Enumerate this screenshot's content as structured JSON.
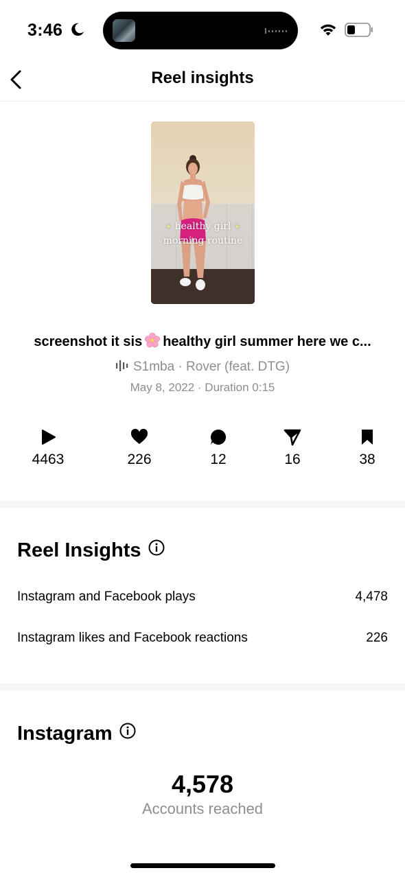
{
  "status_bar": {
    "time": "3:46",
    "icons": [
      "moon-icon",
      "wifi-icon",
      "battery-icon"
    ]
  },
  "header": {
    "title": "Reel insights",
    "back_icon": "chevron-left-icon"
  },
  "reel": {
    "thumbnail_caption_line1": "healthy girl",
    "thumbnail_caption_line2": "morning routine",
    "caption_part1": "screenshot it sis",
    "caption_emoji": "cherry-blossom-icon",
    "caption_part2": "healthy girl summer here we c...",
    "audio": "S1mba · Rover (feat. DTG)",
    "date_duration": "May 8, 2022 · Duration 0:15"
  },
  "stats": [
    {
      "icon": "play-icon",
      "value": "4463"
    },
    {
      "icon": "heart-icon",
      "value": "226"
    },
    {
      "icon": "comment-icon",
      "value": "12"
    },
    {
      "icon": "share-icon",
      "value": "16"
    },
    {
      "icon": "bookmark-icon",
      "value": "38"
    }
  ],
  "reel_insights": {
    "title": "Reel Insights",
    "rows": [
      {
        "label": "Instagram and Facebook plays",
        "value": "4,478"
      },
      {
        "label": "Instagram likes and Facebook reactions",
        "value": "226"
      }
    ]
  },
  "instagram": {
    "title": "Instagram",
    "accounts_reached_value": "4,578",
    "accounts_reached_label": "Accounts reached"
  },
  "colors": {
    "text": "#000000",
    "secondary_text": "#8e8e8e",
    "divider": "#f7f7f7"
  }
}
